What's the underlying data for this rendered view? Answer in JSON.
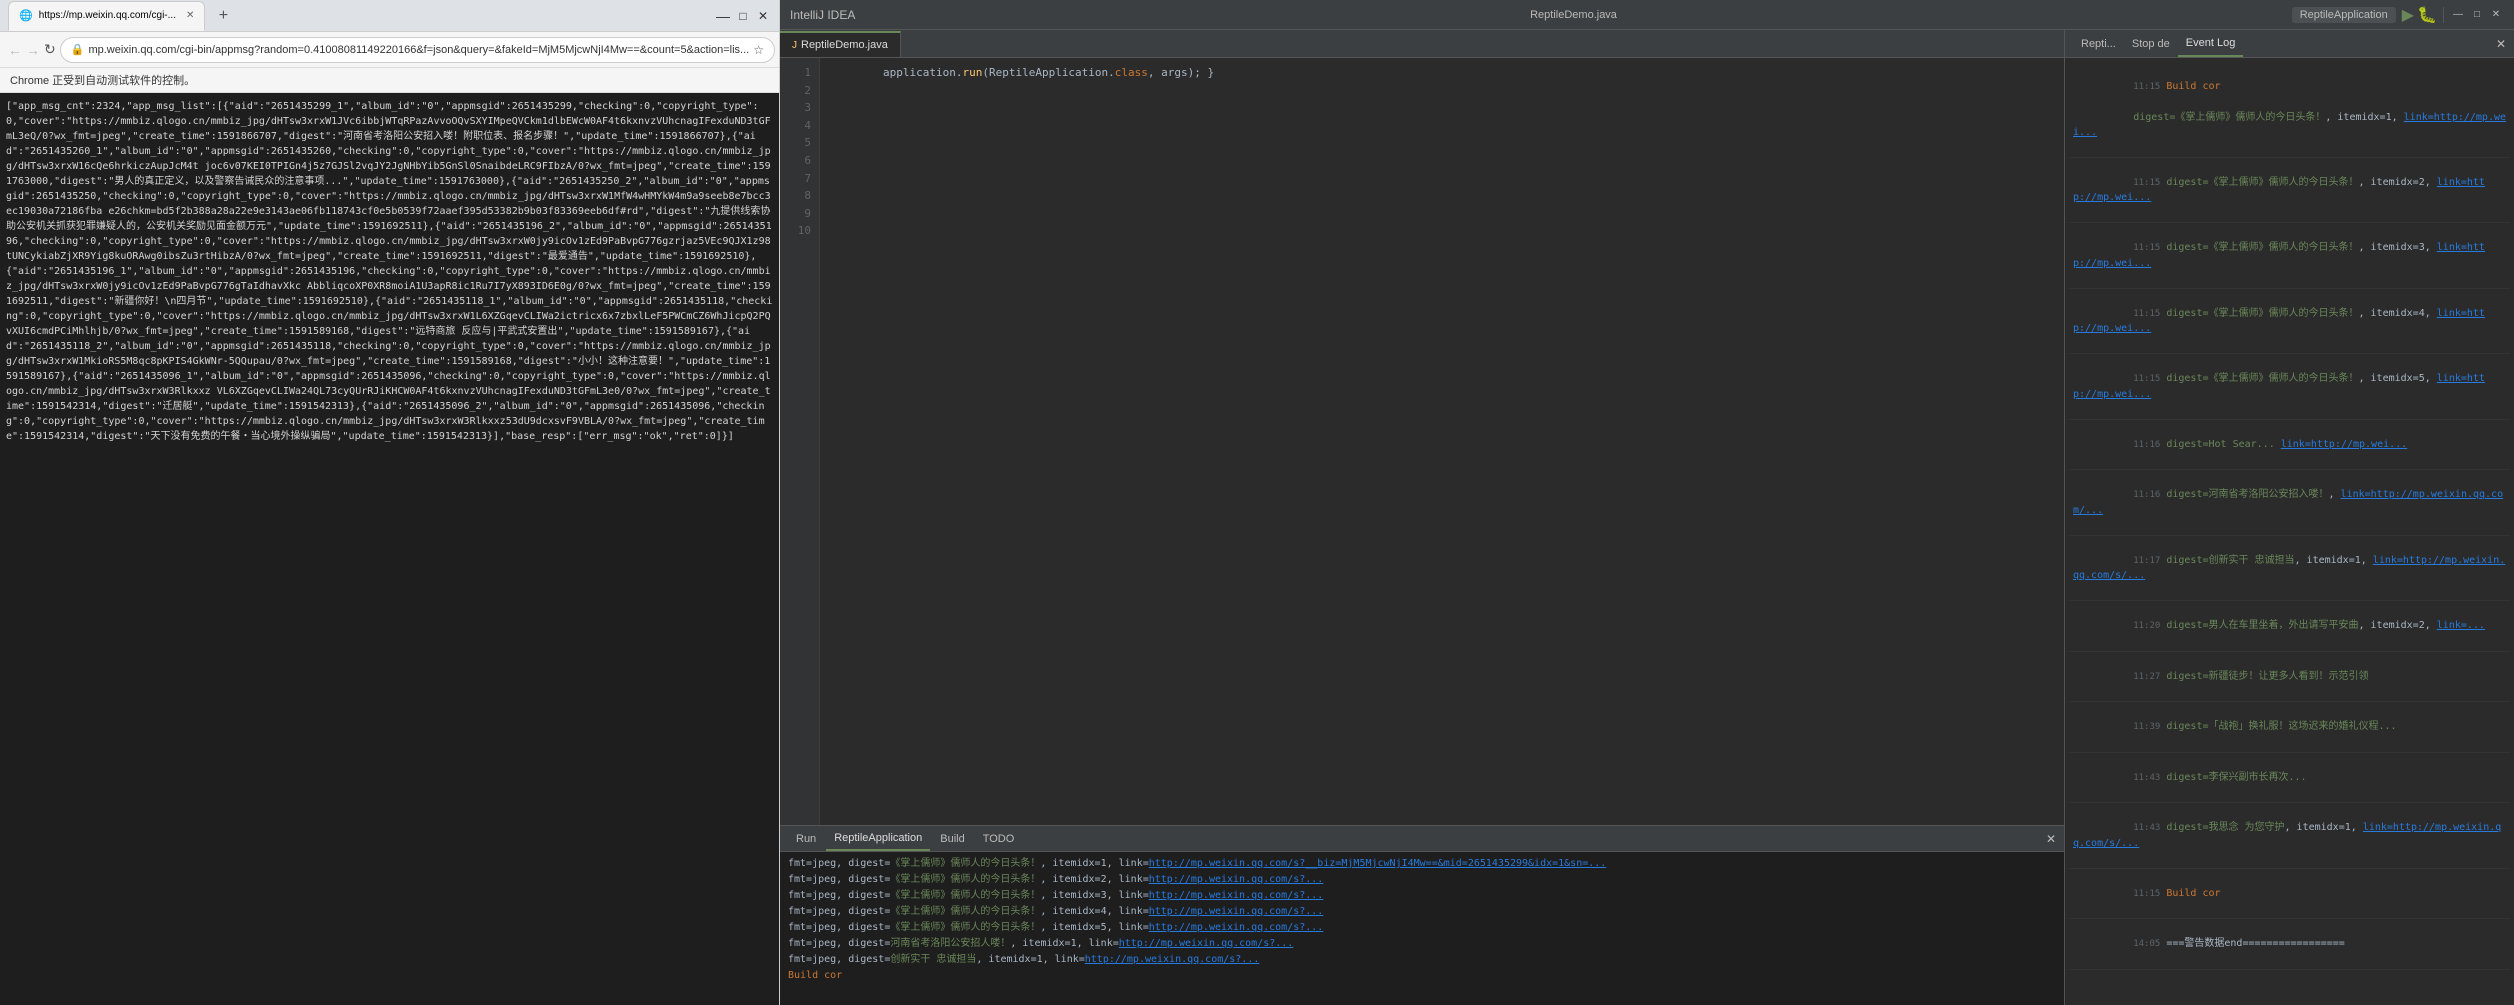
{
  "browser": {
    "titlebar": {
      "title": "https://mp.weixin.qq.com/cgi-...",
      "window_controls": [
        "minimize",
        "maximize",
        "close"
      ]
    },
    "tab": {
      "label": "https://mp.weixin.qq.com/cgi-...",
      "icon": "🌐"
    },
    "address": "mp.weixin.qq.com/cgi-bin/appmsg?random=0.41008081149220166&f=json&query=&fakeId=MjM5MjcwNjI4Mw==&count=5&action=lis...",
    "notification": "Chrome 正受到自动测试软件的控制。",
    "content_preview": "[\"app_msg_cnt\":2324,\"app_msg_list\":[{\"aid\":\"2651435299_1\",\"album_id\":\"0\",\"appmsgid\":2651435299,\"checking\":0,\"copyright_type\":0,\"cover\":\"https://mmbiz.qlogo.cn/mmbiz_jpg/dHTsw3xrxW1JVc6ibbjWTqRPazAvvoOQvSXYIMpeQVCkm1dlbEWcW0AF4t6kxnvzVUhcnagIFexduND3tGFmL3eQ/0?wx_fmt=jpeg\",\"create_time\":1591866707,\"digest\":\"河南省考洛阳公安招入..."
  },
  "ide": {
    "titlebar": {
      "title": "IntelliJ IDEA",
      "run_config": "ReptileApplication",
      "file": "ReptileDemo.java"
    },
    "editor": {
      "filename": "ReptileDemo.java",
      "code_lines": [
        "        application.run(ReptileApplication.class, args); }"
      ]
    },
    "event_log": {
      "tab_label": "Event Log",
      "entries": [
        {
          "time": "11:15",
          "tag": "Build cor",
          "content": "digest=《掌上儒师》儒师人的今日头条！, itemidx=1, link=http://mp.wei...",
          "label": "Stop de"
        },
        {
          "time": "11:15",
          "content": "digest=《掌上儒师》儒师人的今日头条！, itemidx=2, link=http://mp.wei..."
        },
        {
          "time": "11:15",
          "content": "digest=《掌上儒师》儒师人的今日头条！, itemidx=3, link=http://mp.wei..."
        },
        {
          "time": "11:15",
          "content": "digest=《掌上儒师》儒师人的今日头条！, itemidx=4, link=http://mp.wei..."
        },
        {
          "time": "11:15",
          "content": "digest=《掌上儒师》儒师人的今日头条！, itemidx=5, link=http://mp.wei..."
        },
        {
          "time": "11:16",
          "content": "digest=河南省考洛阳公安招入喂！, link=http://mp.weixin.qq.com/..."
        },
        {
          "time": "11:17",
          "content": "digest=创新实干 忠诚担当, itemidx=1, link=http://mp.weixin.qq.com/s/..."
        },
        {
          "time": "11:20",
          "content": "digest=男人在车里坐着，外出请写平安曲, itemidx=2, link=..."
        },
        {
          "time": "11:27",
          "content": "digest=新疆徒步！让更多人看到！示范引领"
        },
        {
          "time": "11:39",
          "content": "digest=「战袍」换礼服！这场迟来的婚礼仪程..."
        },
        {
          "time": "11:43",
          "content": "digest=李保兴副市长再次..."
        },
        {
          "time": "11:43",
          "content": "digest=我思念 为您守护, itemidx=1, link=http://mp.weixin.qq.com/s/..."
        },
        {
          "time": "14:05",
          "content": "===警告数据end================="
        }
      ]
    },
    "run_panel": {
      "tabs": [
        "Run",
        "ReptileApplication",
        "Build",
        "TODO"
      ],
      "active_tab": "ReptileApplication",
      "lines": [
        "fmt=jpeg, digest=《掌上儒师》儒师人的今日头条！, itemidx=1, link=http://mp.weixin.qq.com/s?__biz=MjM5MjcwNjI4Mw==&mid=2651435299&idx=1&sn=...",
        "fmt=jpeg, digest=《掌上儒师》儒师人的今日头条！, itemidx=2, link=http://mp.weixin.qq.com/s?...",
        "fmt=jpeg, digest=《掌上儒师》儒师人的今日头条！, itemidx=3, link=http://mp.weixin.qq.com/s?...",
        "fmt=jpeg, digest=《掌上儒师》儒师人的今日头条！, itemidx=4, link=http://mp.weixin.qq.com/s?...",
        "fmt=jpeg, digest=《掌上儒师》儒师人的今日头条！, itemidx=5, link=http://mp.weixin.qq.com/s?...",
        "fmt=jpeg, digest=河南省考洛阳公安招人喽！, itemidx=1, link=http://mp.weixin.qq.com/s?...",
        "fmt=jpeg, digest=创新实干 忠诚担当, itemidx=1, link=http://mp.weixin.qq.com/s?...",
        "Build cor"
      ]
    }
  }
}
